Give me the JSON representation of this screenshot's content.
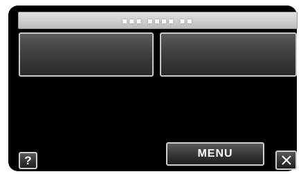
{
  "title_bar": {
    "text": "▪▪▪ ▪▪▪▪ ▪▪"
  },
  "tiles": [
    {
      "label": ""
    },
    {
      "label": ""
    }
  ],
  "footer": {
    "help_label": "?",
    "menu_label": "MENU",
    "close_icon": "close-icon"
  },
  "colors": {
    "screen_background": "#000000",
    "button_border": "#d0d0d0",
    "title_bar": "#cfcfcf"
  }
}
